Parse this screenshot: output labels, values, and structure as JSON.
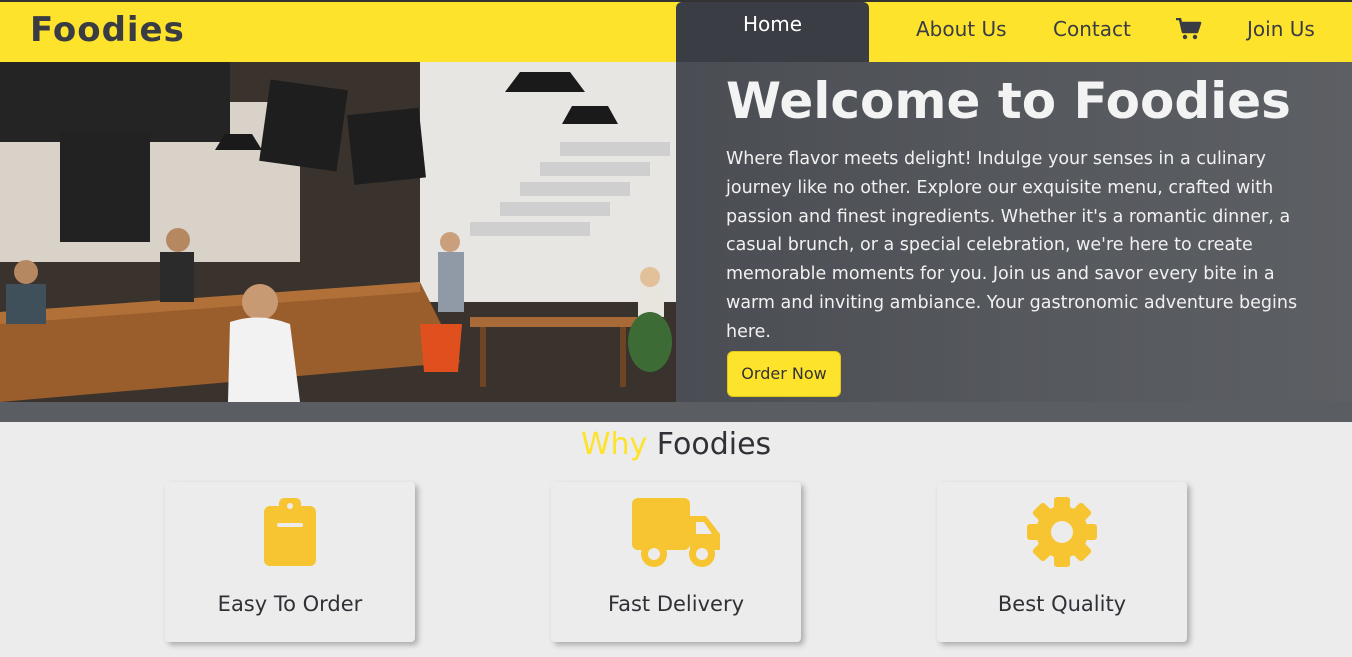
{
  "header": {
    "logo": "Foodies",
    "nav": {
      "home": "Home",
      "about": "About Us",
      "contact": "Contact",
      "cart_icon": "shopping-cart-icon",
      "join": "Join Us"
    }
  },
  "hero": {
    "image_alt": "cafe interior",
    "title": "Welcome to Foodies",
    "text": "Where flavor meets delight! Indulge your senses in a culinary journey like no other. Explore our exquisite menu, crafted with passion and finest ingredients. Whether it's a romantic dinner, a casual brunch, or a special celebration, we're here to create memorable moments for you. Join us and savor every bite in a warm and inviting ambiance. Your gastronomic adventure begins here.",
    "button": "Order Now"
  },
  "why": {
    "title_accent": "Why",
    "title_rest": "Foodies"
  },
  "features": [
    {
      "label": "Easy To Order",
      "icon": "clipboard-icon"
    },
    {
      "label": "Fast Delivery",
      "icon": "truck-icon"
    },
    {
      "label": "Best Quality",
      "icon": "gear-icon"
    }
  ],
  "colors": {
    "brand_yellow": "#fde32c",
    "icon_yellow": "#f7c531",
    "dark": "#3b3d44"
  }
}
